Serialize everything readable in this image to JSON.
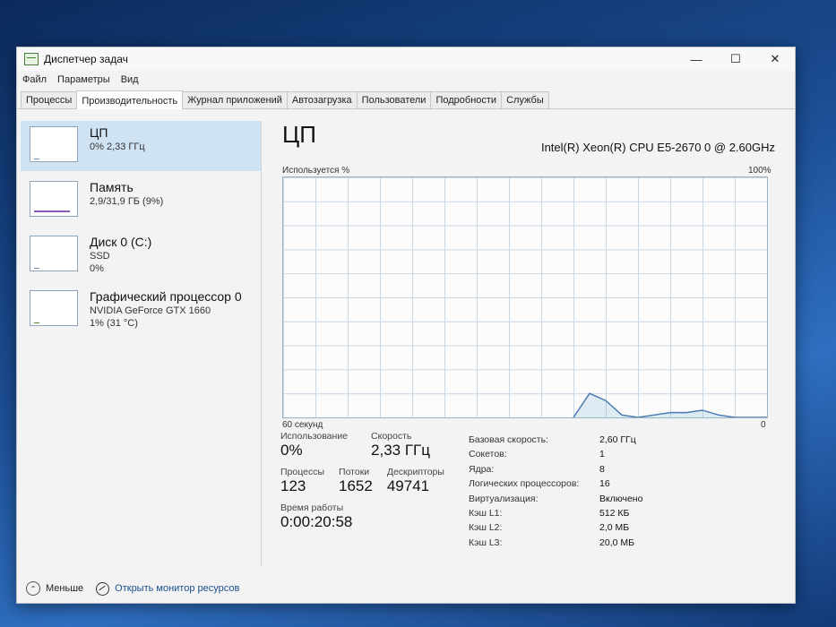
{
  "window": {
    "title": "Диспетчер задач",
    "controls": [
      "—",
      "☐",
      "✕"
    ]
  },
  "menu": [
    "Файл",
    "Параметры",
    "Вид"
  ],
  "tabs": [
    "Процессы",
    "Производительность",
    "Журнал приложений",
    "Автозагрузка",
    "Пользователи",
    "Подробности",
    "Службы"
  ],
  "active_tab": "Производительность",
  "sidebar": {
    "items": [
      {
        "title": "ЦП",
        "line1": "0% 2,33 ГГц",
        "line2": ""
      },
      {
        "title": "Память",
        "line1": "2,9/31,9 ГБ (9%)",
        "line2": ""
      },
      {
        "title": "Диск 0 (C:)",
        "line1": "SSD",
        "line2": "0%"
      },
      {
        "title": "Графический процессор 0",
        "line1": "NVIDIA GeForce GTX 1660",
        "line2": "1% (31 °C)"
      }
    ]
  },
  "main": {
    "title": "ЦП",
    "cpu_model": "Intel(R) Xeon(R) CPU E5-2670 0 @ 2.60GHz",
    "graph": {
      "ylabel": "Используется %",
      "ymax_label": "100%",
      "xlabel_left": "60 секунд",
      "xlabel_right": "0"
    },
    "stats": {
      "usage_label": "Использование",
      "usage_value": "0%",
      "speed_label": "Скорость",
      "speed_value": "2,33 ГГц",
      "processes_label": "Процессы",
      "processes_value": "123",
      "threads_label": "Потоки",
      "threads_value": "1652",
      "handles_label": "Дескрипторы",
      "handles_value": "49741",
      "uptime_label": "Время работы",
      "uptime_value": "0:00:20:58"
    },
    "specs": [
      {
        "key": "Базовая скорость:",
        "value": "2,60 ГГц"
      },
      {
        "key": "Сокетов:",
        "value": "1"
      },
      {
        "key": "Ядра:",
        "value": "8"
      },
      {
        "key": "Логических процессоров:",
        "value": "16"
      },
      {
        "key": "Виртуализация:",
        "value": "Включено"
      },
      {
        "key": "Кэш L1:",
        "value": "512 КБ"
      },
      {
        "key": "Кэш L2:",
        "value": "2,0 МБ"
      },
      {
        "key": "Кэш L3:",
        "value": "20,0 МБ"
      }
    ]
  },
  "chart_data": {
    "type": "line",
    "x": [
      60,
      58,
      56,
      54,
      52,
      50,
      48,
      46,
      44,
      42,
      40,
      38,
      36,
      34,
      32,
      30,
      28,
      26,
      24,
      22,
      20,
      18,
      16,
      14,
      12,
      10,
      8,
      6,
      4,
      2,
      0
    ],
    "series": [
      {
        "values": [
          null,
          null,
          null,
          null,
          null,
          null,
          null,
          null,
          null,
          null,
          null,
          null,
          null,
          null,
          null,
          null,
          null,
          null,
          0,
          10,
          7,
          1,
          0,
          1,
          2,
          2,
          3,
          1,
          0,
          0,
          0
        ]
      }
    ],
    "ylim": [
      0,
      100
    ],
    "xlim": [
      60,
      0
    ],
    "grid": true
  },
  "footer": {
    "less_label": "Меньше",
    "monitor_label": "Открыть монитор ресурсов"
  },
  "colors": {
    "accent": "#cfe3f3",
    "line": "#4a7bb0"
  }
}
